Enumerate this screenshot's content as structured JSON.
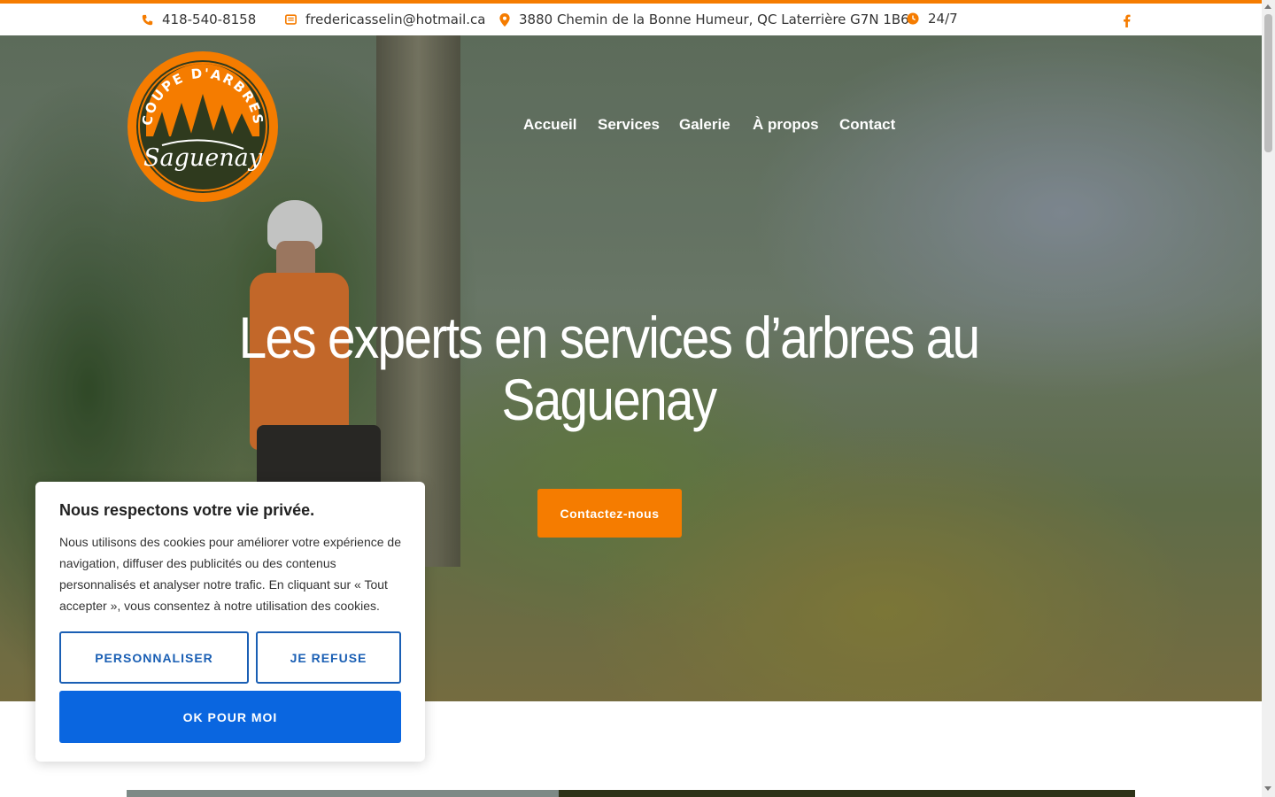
{
  "colors": {
    "accent": "#f57c00",
    "cookie_primary": "#0a66e0",
    "cookie_outline": "#1a5fb4"
  },
  "topbar": {
    "phone": {
      "icon": "phone-icon",
      "text": "418-540-8158"
    },
    "email": {
      "icon": "envelope-icon",
      "text": "fredericasselin@hotmail.ca"
    },
    "address": {
      "icon": "map-pin-icon",
      "text": "3880 Chemin de la Bonne Humeur, QC Laterrière G7N 1B6"
    },
    "hours": {
      "icon": "clock-icon",
      "text": "24/7"
    },
    "social": {
      "icon": "facebook-icon"
    }
  },
  "logo": {
    "top_text": "COUPE D'ARBRES",
    "bottom_text": "Saguenay"
  },
  "nav": {
    "items": [
      "Accueil",
      "Services",
      "Galerie",
      "À propos",
      "Contact"
    ]
  },
  "hero": {
    "title_line1": "Les experts en services d’arbres au",
    "title_line2": "Saguenay",
    "cta_label": "Contactez-nous"
  },
  "cookie": {
    "title": "Nous respectons votre vie privée.",
    "body": "Nous utilisons des cookies pour améliorer votre expérience de navigation, diffuser des publicités ou des contenus personnalisés et analyser notre trafic. En cliquant sur « Tout accepter », vous consentez à notre utilisation des cookies.",
    "customize_label": "PERSONNALISER",
    "refuse_label": "JE REFUSE",
    "accept_label": "OK POUR MOI"
  }
}
